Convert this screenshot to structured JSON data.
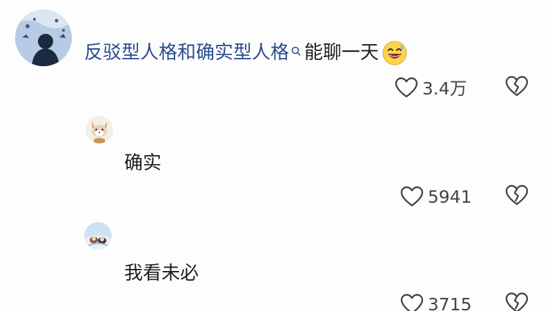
{
  "comment": {
    "topic_text": "反驳型人格和确实型人格",
    "tail_text": "能聊一天",
    "emoji_icon": "grinning-sweat-emoji",
    "likes": "3.4万"
  },
  "replies": [
    {
      "text": "确实",
      "likes": "5941",
      "avatar_icon": "fox-avatar"
    },
    {
      "text": "我看未必",
      "likes": "3715",
      "avatar_icon": "character-avatar"
    }
  ],
  "colors": {
    "topic_link": "#2b4c8f",
    "icon_stroke": "#444444"
  }
}
